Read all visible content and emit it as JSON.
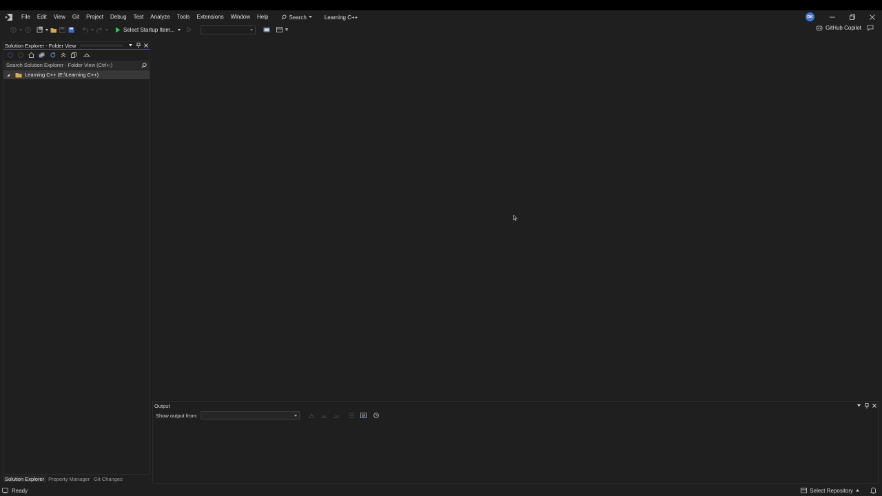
{
  "menu": {
    "items": [
      "File",
      "Edit",
      "View",
      "Git",
      "Project",
      "Debug",
      "Test",
      "Analyze",
      "Tools",
      "Extensions",
      "Window",
      "Help"
    ],
    "search_label": "Search",
    "solution_name": "Learning C++",
    "avatar_initials": "DK"
  },
  "toolbar": {
    "startup_label": "Select Startup Item...",
    "copilot_label": "GitHub Copilot"
  },
  "solution_explorer": {
    "title": "Solution Explorer - Folder View",
    "search_placeholder": "Search Solution Explorer - Folder View (Ctrl+;)",
    "root_item": "Learning C++ (E:\\Learning C++)"
  },
  "bottom_tabs": [
    "Solution Explorer",
    "Property Manager",
    "Git Changes"
  ],
  "output": {
    "title": "Output",
    "show_from_label": "Show output from:"
  },
  "status": {
    "ready": "Ready",
    "repo_label": "Select Repository"
  },
  "colors": {
    "background": "#1f1f1f",
    "accent": "#5b4fb5",
    "avatar": "#3b78d8",
    "run_green": "#3dbf55"
  }
}
